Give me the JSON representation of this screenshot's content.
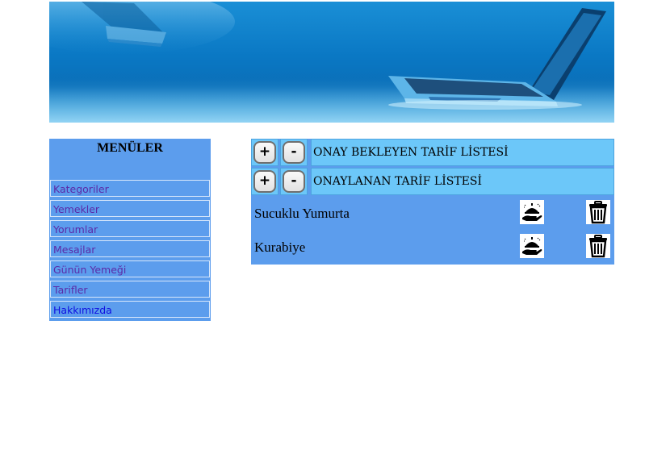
{
  "sidebar": {
    "title": "MENÜLER",
    "items": [
      {
        "label": "Kategoriler"
      },
      {
        "label": "Yemekler"
      },
      {
        "label": "Yorumlar"
      },
      {
        "label": "Mesajlar"
      },
      {
        "label": "Günün Yemeği"
      },
      {
        "label": "Tarifler"
      },
      {
        "label": "Hakkımızda"
      }
    ]
  },
  "sections": [
    {
      "plus_label": "+",
      "minus_label": "-",
      "title": "ONAY BEKLEYEN TARİF LİSTESİ"
    },
    {
      "plus_label": "+",
      "minus_label": "-",
      "title": "ONAYLANAN TARİF LİSTESİ"
    }
  ],
  "recipes": [
    {
      "name": "Sucuklu Yumurta",
      "approve_icon": "serve-dish-icon",
      "delete_icon": "trash-icon"
    },
    {
      "name": "Kurabiye",
      "approve_icon": "serve-dish-icon",
      "delete_icon": "trash-icon"
    }
  ],
  "colors": {
    "panel_blue": "#5c9ded",
    "header_light_blue": "#6cc7f9",
    "link_visited": "#5b2aa8",
    "link_active": "#1010e0"
  }
}
